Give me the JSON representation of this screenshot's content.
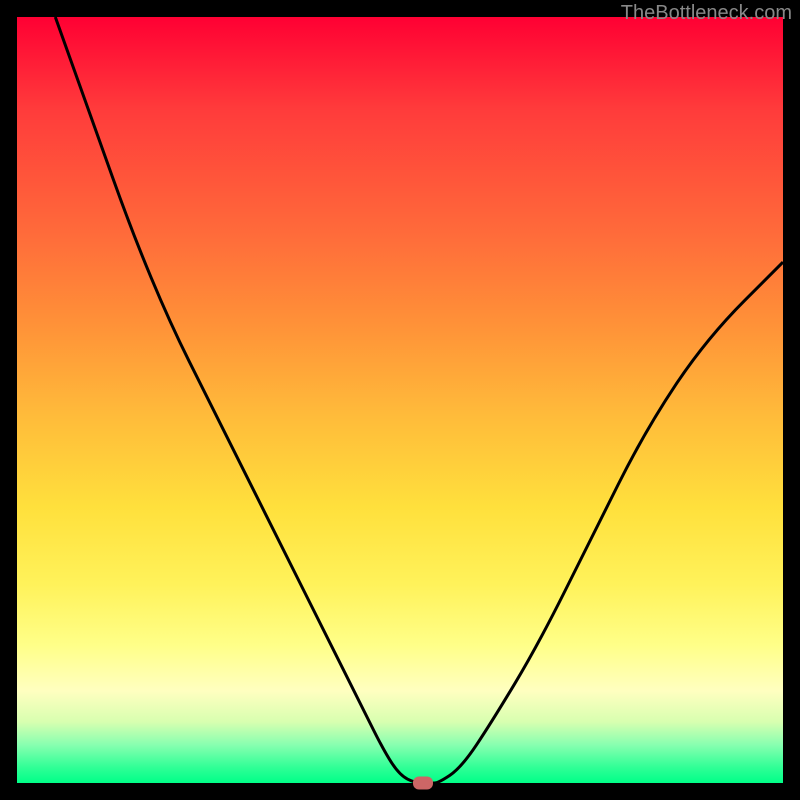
{
  "watermark": "TheBottleneck.com",
  "chart_data": {
    "type": "line",
    "title": "",
    "xlabel": "",
    "ylabel": "",
    "xlim": [
      0,
      100
    ],
    "ylim": [
      0,
      100
    ],
    "grid": false,
    "legend": false,
    "series": [
      {
        "name": "curve",
        "x": [
          5,
          10,
          15,
          20,
          25,
          30,
          35,
          40,
          45,
          48,
          50,
          52,
          54,
          55,
          58,
          62,
          68,
          75,
          82,
          90,
          100
        ],
        "y": [
          100,
          86,
          72,
          60,
          50,
          40,
          30,
          20,
          10,
          4,
          1,
          0,
          0,
          0,
          2,
          8,
          18,
          32,
          46,
          58,
          68
        ]
      }
    ],
    "marker": {
      "x": 53,
      "y": 0
    },
    "background_gradient": {
      "top_color": "#ff0033",
      "bottom_color": "#00ff88"
    }
  }
}
